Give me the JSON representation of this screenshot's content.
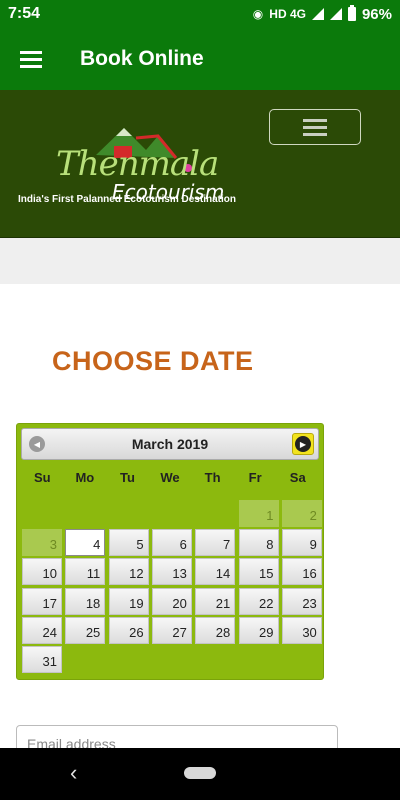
{
  "status_bar": {
    "time": "7:54",
    "network": "HD 4G",
    "battery": "96%"
  },
  "appbar": {
    "title": "Book Online"
  },
  "site_header": {
    "logo_main": "Thenmala",
    "logo_sub": "Ecotourism",
    "tagline": "India's First Palanned Ecotourism Destination"
  },
  "heading": "CHOOSE DATE",
  "calendar": {
    "month_label": "March 2019",
    "weekdays": [
      "Su",
      "Mo",
      "Tu",
      "We",
      "Th",
      "Fr",
      "Sa"
    ],
    "disabled_days": [
      1,
      2,
      3
    ],
    "selected_day": 4,
    "days": [
      "1",
      "2",
      "3",
      "4",
      "5",
      "6",
      "7",
      "8",
      "9",
      "10",
      "11",
      "12",
      "13",
      "14",
      "15",
      "16",
      "17",
      "18",
      "19",
      "20",
      "21",
      "22",
      "23",
      "24",
      "25",
      "26",
      "27",
      "28",
      "29",
      "30",
      "31"
    ]
  },
  "email": {
    "placeholder": "Email address"
  },
  "colors": {
    "appbar": "#0b7a0b",
    "header_bg": "#2b4a06",
    "heading": "#c7641a",
    "calendar_bg": "#8cb90e"
  }
}
